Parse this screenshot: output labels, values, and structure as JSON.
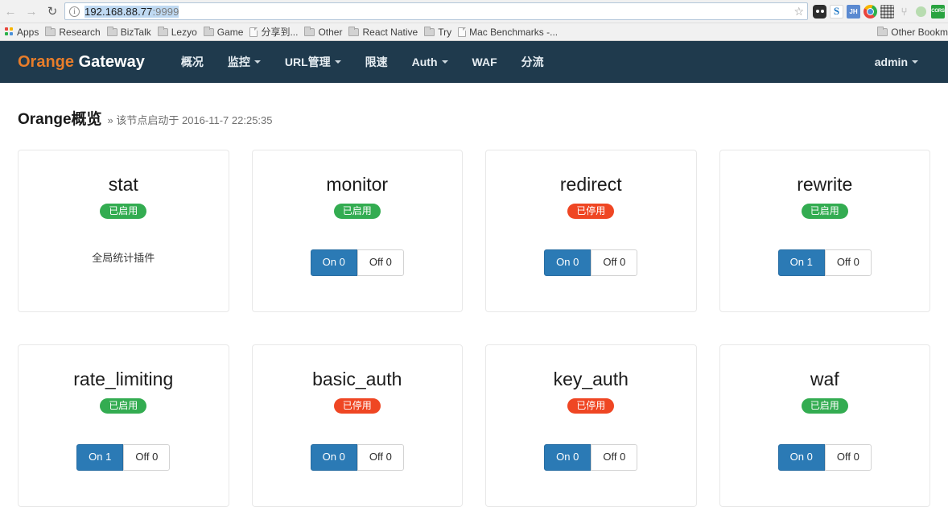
{
  "browser": {
    "back_icon": "back-arrow-icon",
    "forward_icon": "forward-arrow-icon",
    "reload_icon": "reload-icon",
    "info_icon": "info-icon",
    "url_host": "192.168.88.77",
    "url_port": ":9999",
    "star_icon": "star-icon",
    "extensions": [
      {
        "name": "bear-extension-icon",
        "label": ""
      },
      {
        "name": "sogou-extension-icon",
        "label": "S"
      },
      {
        "name": "jh-extension-icon",
        "label": "JH"
      },
      {
        "name": "chrome-extension-icon",
        "label": ""
      },
      {
        "name": "qrcode-extension-icon",
        "label": ""
      },
      {
        "name": "y-extension-icon",
        "label": "⑂"
      },
      {
        "name": "green-dot-extension-icon",
        "label": ""
      },
      {
        "name": "cors-extension-icon",
        "label": "CORS"
      }
    ],
    "bookmarks": [
      {
        "label": "Apps",
        "icon": "apps-grid-icon"
      },
      {
        "label": "Research",
        "icon": "folder-icon"
      },
      {
        "label": "BizTalk",
        "icon": "folder-icon"
      },
      {
        "label": "Lezyo",
        "icon": "folder-icon"
      },
      {
        "label": "Game",
        "icon": "folder-icon"
      },
      {
        "label": "分享到...",
        "icon": "page-icon"
      },
      {
        "label": "Other",
        "icon": "folder-icon"
      },
      {
        "label": "React Native",
        "icon": "folder-icon"
      },
      {
        "label": "Try",
        "icon": "folder-icon"
      },
      {
        "label": "Mac Benchmarks -...",
        "icon": "page-icon"
      }
    ],
    "other_bookmarks_label": "Other Bookm"
  },
  "navbar": {
    "brand_highlight": "Orange",
    "brand_rest": "Gateway",
    "items": [
      {
        "label": "概况",
        "caret": false
      },
      {
        "label": "监控",
        "caret": true
      },
      {
        "label": "URL管理",
        "caret": true
      },
      {
        "label": "限速",
        "caret": false
      },
      {
        "label": "Auth",
        "caret": true
      },
      {
        "label": "WAF",
        "caret": false
      },
      {
        "label": "分流",
        "caret": false
      }
    ],
    "user": "admin"
  },
  "heading": {
    "title": "Orange概览",
    "subtitle": "» 该节点启动于 2016-11-7 22:25:35"
  },
  "colors": {
    "navbar_bg": "#1f3a4d",
    "brand_orange": "#e87d2a",
    "badge_enabled": "#33ac51",
    "badge_disabled": "#ef4623",
    "button_primary": "#2b7ab5"
  },
  "cards": [
    {
      "title": "stat",
      "status": "已启用",
      "status_state": "enabled",
      "description": "全局统计插件",
      "has_buttons": false,
      "on_label": "",
      "off_label": ""
    },
    {
      "title": "monitor",
      "status": "已启用",
      "status_state": "enabled",
      "description": "",
      "has_buttons": true,
      "on_label": "On 0",
      "off_label": "Off 0"
    },
    {
      "title": "redirect",
      "status": "已停用",
      "status_state": "disabled",
      "description": "",
      "has_buttons": true,
      "on_label": "On 0",
      "off_label": "Off 0"
    },
    {
      "title": "rewrite",
      "status": "已启用",
      "status_state": "enabled",
      "description": "",
      "has_buttons": true,
      "on_label": "On 1",
      "off_label": "Off 0"
    },
    {
      "title": "rate_limiting",
      "status": "已启用",
      "status_state": "enabled",
      "description": "",
      "has_buttons": true,
      "on_label": "On 1",
      "off_label": "Off 0"
    },
    {
      "title": "basic_auth",
      "status": "已停用",
      "status_state": "disabled",
      "description": "",
      "has_buttons": true,
      "on_label": "On 0",
      "off_label": "Off 0"
    },
    {
      "title": "key_auth",
      "status": "已停用",
      "status_state": "disabled",
      "description": "",
      "has_buttons": true,
      "on_label": "On 0",
      "off_label": "Off 0"
    },
    {
      "title": "waf",
      "status": "已启用",
      "status_state": "enabled",
      "description": "",
      "has_buttons": true,
      "on_label": "On 0",
      "off_label": "Off 0"
    }
  ]
}
